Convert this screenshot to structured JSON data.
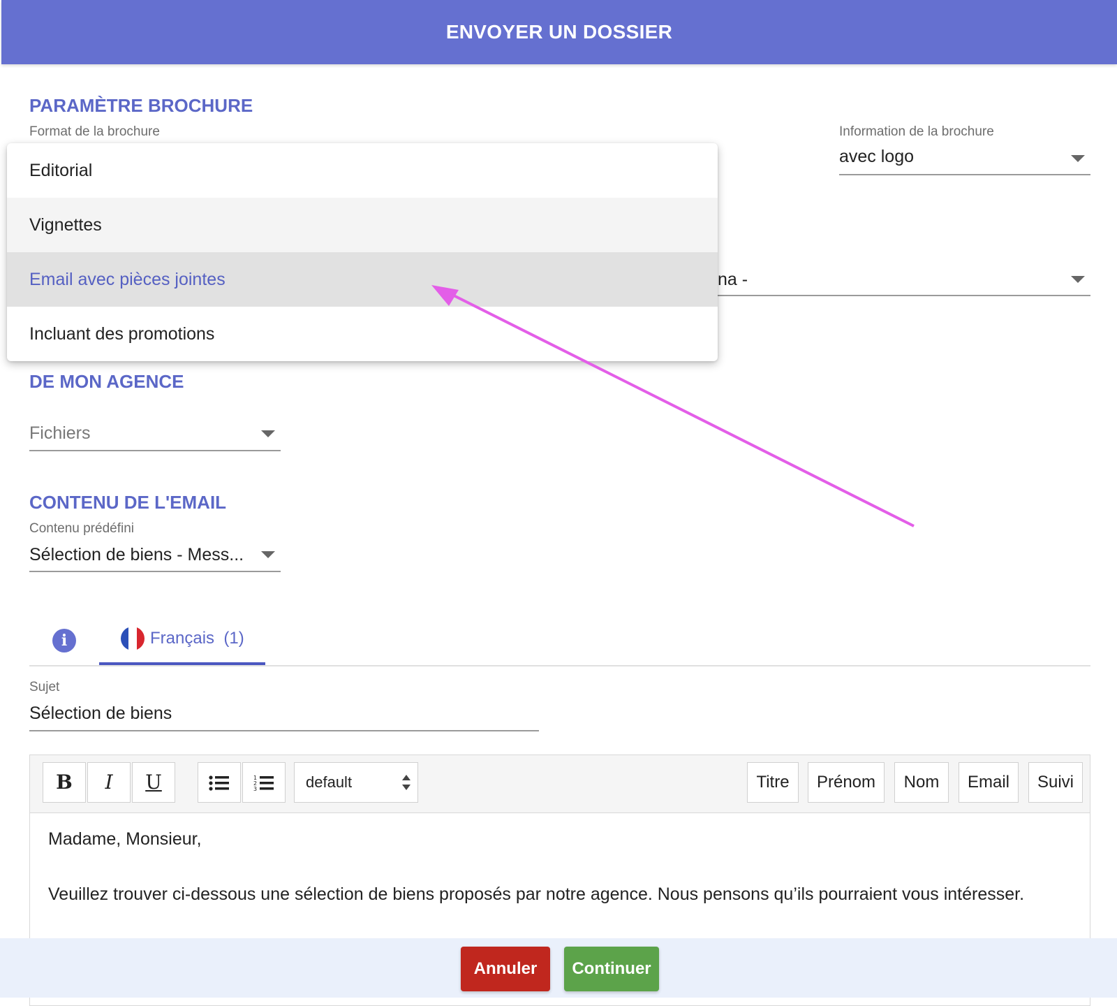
{
  "header": {
    "title": "ENVOYER UN DOSSIER"
  },
  "brochure": {
    "section_title": "PARAMÈTRE BROCHURE",
    "format_label": "Format de la brochure",
    "info_label": "Information de la brochure",
    "info_value": "avec logo",
    "hidden_select_partial": "na -",
    "format_options": [
      "Editorial",
      "Vignettes",
      "Email avec pièces jointes",
      "Incluant des promotions"
    ],
    "selected_option": "Email avec pièces jointes",
    "hovered_option": "Vignettes"
  },
  "agence": {
    "section_title": "DE MON AGENCE",
    "files_placeholder": "Fichiers"
  },
  "email": {
    "section_title": "CONTENU DE L'EMAIL",
    "predefined_label": "Contenu prédéfini",
    "predefined_value": "Sélection de biens - Mess...",
    "tabs": {
      "info_icon": "info-icon",
      "language": "Français",
      "count": "(1)"
    },
    "subject_label": "Sujet",
    "subject_value": "Sélection de biens"
  },
  "editor": {
    "bold": "B",
    "italic": "I",
    "underline": "U",
    "font_select": "default",
    "placeholders": [
      "Titre",
      "Prénom",
      "Nom",
      "Email",
      "Suivi"
    ],
    "body_line1": "Madame, Monsieur,",
    "body_line2": "Veuillez trouver ci-dessous une sélection de biens proposés par notre agence. Nous pensons qu’ils pourraient vous intéresser."
  },
  "footer": {
    "cancel": "Annuler",
    "continue": "Continuer"
  },
  "colors": {
    "header": "#6570d0",
    "accent": "#5b67c7",
    "cancel": "#c0271e",
    "continue": "#5ca34a",
    "annotation_arrow": "#e35ee8"
  }
}
